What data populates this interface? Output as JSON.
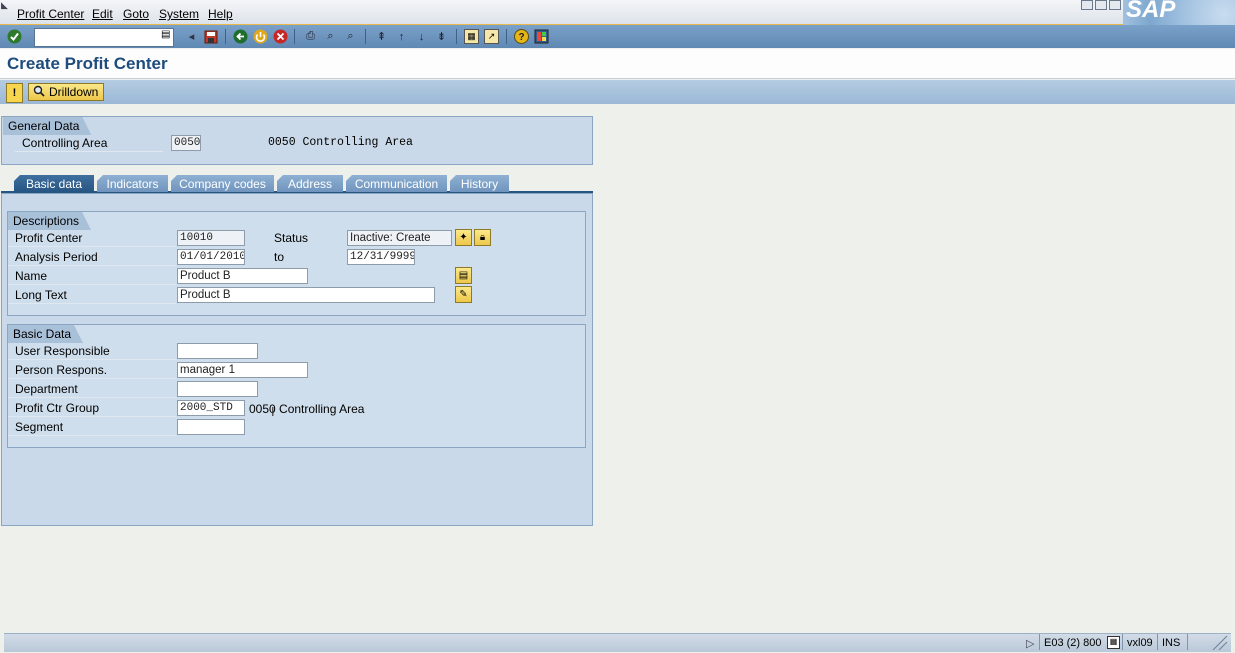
{
  "menu": {
    "items": [
      "Profit Center",
      "Edit",
      "Goto",
      "System",
      "Help"
    ]
  },
  "brand": {
    "logo_text": "SAP"
  },
  "toolbar": {
    "command_value": "",
    "icons": [
      "enter-icon",
      "back-icon",
      "save-icon",
      "green-back-icon",
      "exit-icon",
      "cancel-icon",
      "print-icon",
      "find-icon",
      "find-next-icon",
      "first-page-icon",
      "previous-page-icon",
      "next-page-icon",
      "last-page-icon",
      "create-session-icon",
      "shortcut-icon",
      "help-icon",
      "layout-icon"
    ]
  },
  "page": {
    "title": "Create Profit Center"
  },
  "app_toolbar": {
    "drilldown_label": "Drilldown",
    "warning_symbol": "!"
  },
  "general_data": {
    "section_title": "General Data",
    "controlling_area_label": "Controlling Area",
    "controlling_area_value": "0050",
    "controlling_area_desc": "0050 Controlling Area"
  },
  "tabs": [
    {
      "label": "Basic data",
      "active": true
    },
    {
      "label": "Indicators",
      "active": false
    },
    {
      "label": "Company codes",
      "active": false
    },
    {
      "label": "Address",
      "active": false
    },
    {
      "label": "Communication",
      "active": false
    },
    {
      "label": "History",
      "active": false
    }
  ],
  "descriptions": {
    "section_title": "Descriptions",
    "profit_center_label": "Profit Center",
    "profit_center_value": "10010",
    "status_label": "Status",
    "status_value": "Inactive: Create",
    "analysis_period_label": "Analysis Period",
    "analysis_from": "01/01/2010",
    "to_label": "to",
    "analysis_to": "12/31/9999",
    "name_label": "Name",
    "name_value": "Product B",
    "long_text_label": "Long Text",
    "long_text_value": "Product B"
  },
  "basic_data": {
    "section_title": "Basic Data",
    "user_responsible_label": "User Responsible",
    "user_responsible_value": "",
    "person_respons_label": "Person Respons.",
    "person_respons_value": "manager 1",
    "department_label": "Department",
    "department_value": "",
    "profit_ctr_group_label": "Profit Ctr Group",
    "profit_ctr_group_value": "2000_STD",
    "profit_ctr_group_desc": "0050 Controlling Area",
    "segment_label": "Segment",
    "segment_value": ""
  },
  "status_bar": {
    "system": "E03 (2) 800",
    "server": "vxl09",
    "mode": "INS"
  }
}
